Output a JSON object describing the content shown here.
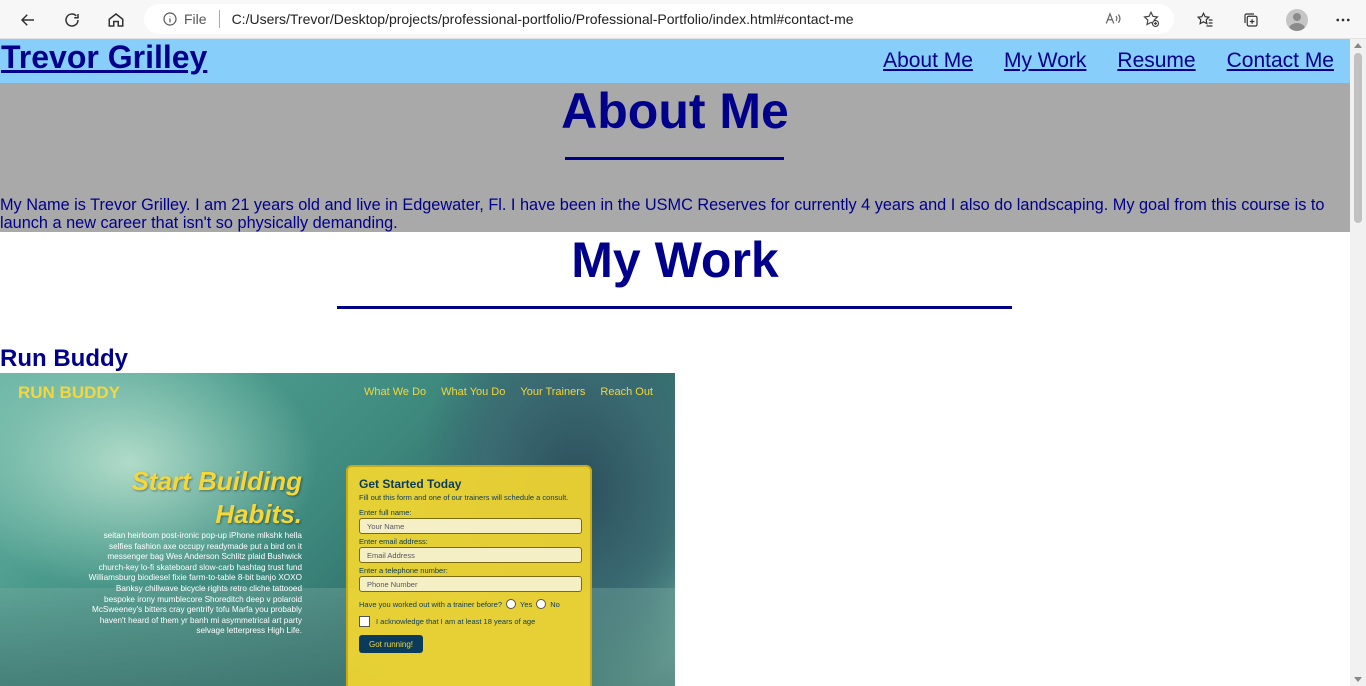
{
  "browser": {
    "info_label": "File",
    "url": "C:/Users/Trevor/Desktop/projects/professional-portfolio/Professional-Portfolio/index.html#contact-me"
  },
  "site": {
    "brand": "Trevor Grilley",
    "nav": [
      "About Me",
      "My Work",
      "Resume",
      "Contact Me"
    ]
  },
  "about": {
    "heading": "About Me",
    "body": "My Name is Trevor Grilley. I am 21 years old and live in Edgewater, Fl. I have been in the USMC Reserves for currently 4 years and I also do landscaping. My goal from this course is to launch a new career that isn't so physically demanding."
  },
  "work": {
    "heading": "My Work",
    "project_title": "Run Buddy",
    "preview": {
      "brand": "RUN BUDDY",
      "nav": [
        "What We Do",
        "What You Do",
        "Your Trainers",
        "Reach Out"
      ],
      "hero_line1": "Start Building",
      "hero_line2": "Habits.",
      "copy": "seitan heirloom post-ironic pop-up iPhone mlkshk hella selfies fashion axe occupy readymade put a bird on it messenger bag Wes Anderson Schlitz plaid Bushwick church-key lo-fi skateboard slow-carb hashtag trust fund Williamsburg biodiesel fixie farm-to-table 8-bit banjo XOXO Banksy chillwave bicycle rights retro cliche tattooed bespoke irony mumblecore Shoreditch deep v polaroid McSweeney's bitters cray gentrify tofu Marfa you probably haven't heard of them yr banh mi asymmetrical art party selvage letterpress High Life.",
      "form_title": "Get Started Today",
      "form_sub": "Fill out this form and one of our trainers will schedule a consult.",
      "label_name": "Enter full name:",
      "ph_name": "Your Name",
      "label_email": "Enter email address:",
      "ph_email": "Email Address",
      "label_phone": "Enter a telephone number:",
      "ph_phone": "Phone Number",
      "question": "Have you worked out with a trainer before?",
      "opt_yes": "Yes",
      "opt_no": "No",
      "ack": "I acknowledge that I am at least 18 years of age",
      "submit": "Got running!"
    }
  }
}
